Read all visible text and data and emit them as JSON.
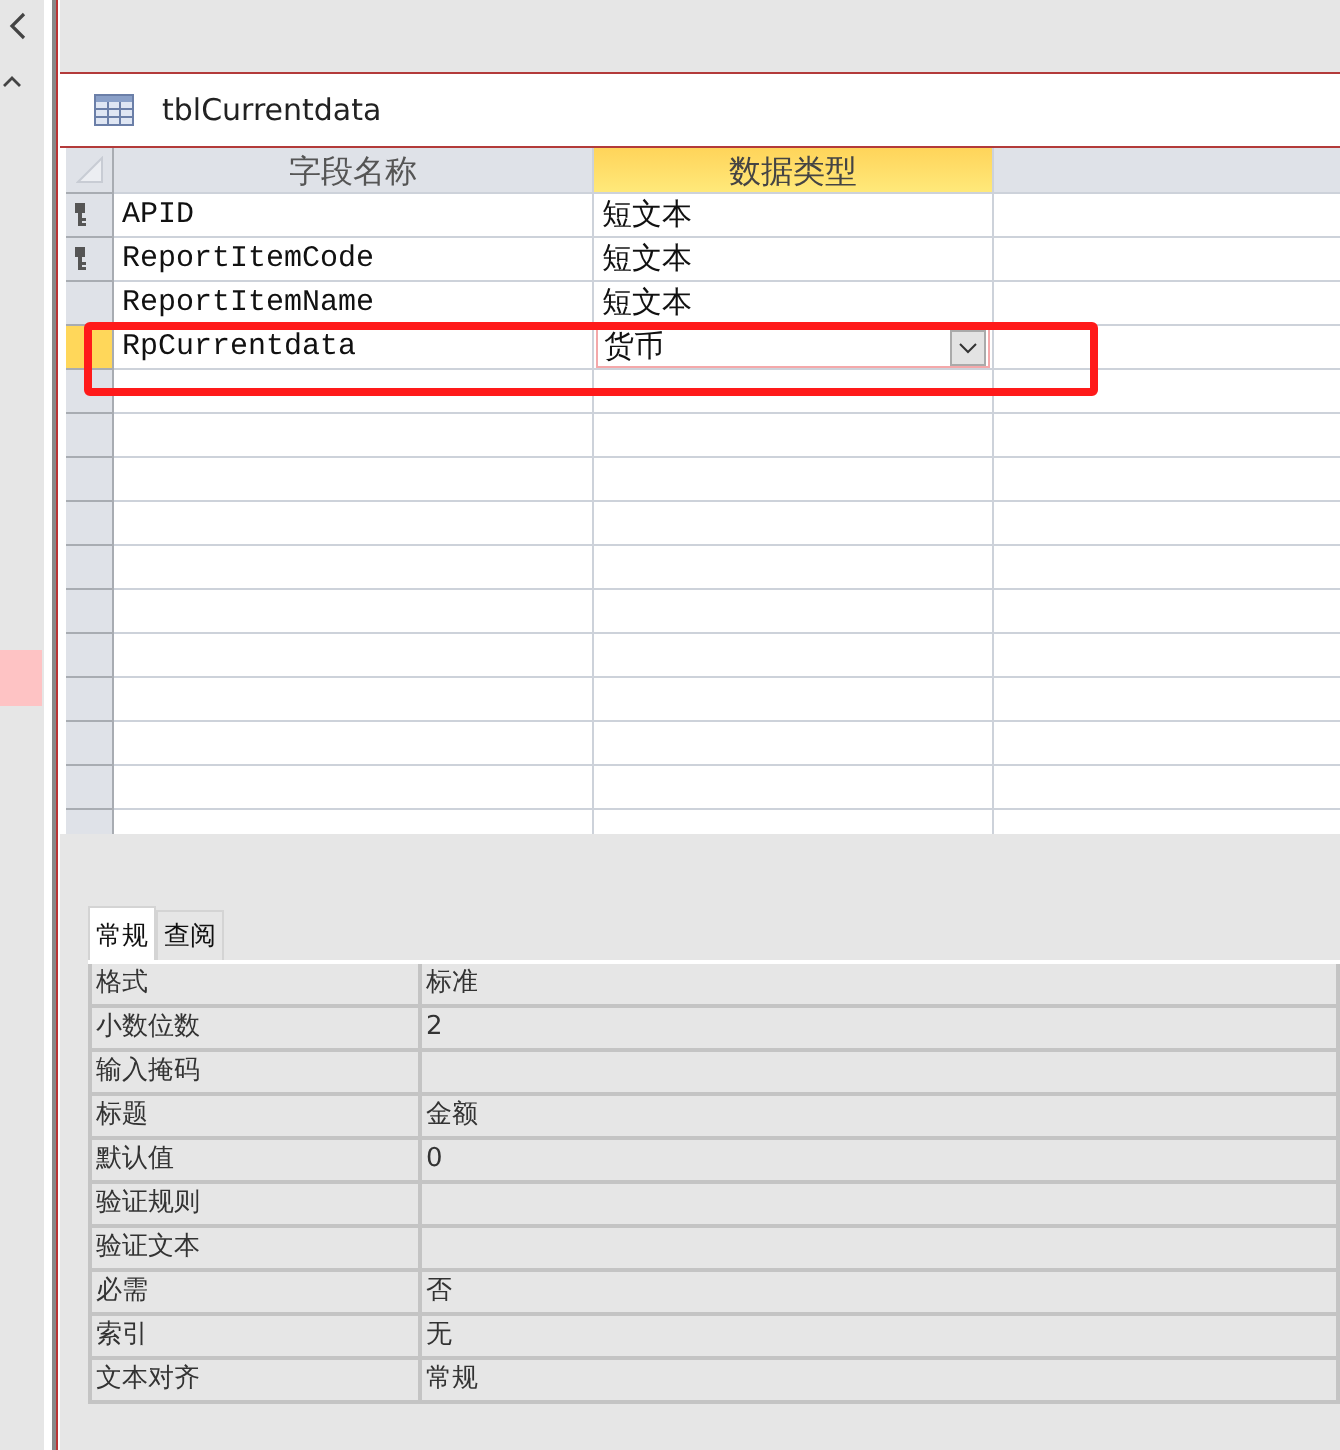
{
  "table_title": "tblCurrentdata",
  "grid": {
    "columns": [
      {
        "label": "字段名称",
        "selected": false
      },
      {
        "label": "数据类型",
        "selected": true
      }
    ],
    "rows": [
      {
        "name": "APID",
        "type": "短文本",
        "primary_key": true,
        "selected": false
      },
      {
        "name": "ReportItemCode",
        "type": "短文本",
        "primary_key": true,
        "selected": false
      },
      {
        "name": "ReportItemName",
        "type": "短文本",
        "primary_key": false,
        "selected": false
      },
      {
        "name": "RpCurrentdata",
        "type": "货币",
        "primary_key": false,
        "selected": true
      }
    ]
  },
  "properties": {
    "tabs": [
      {
        "label": "常规",
        "selected": true
      },
      {
        "label": "查阅",
        "selected": false
      }
    ],
    "rows": [
      {
        "label": "格式",
        "value": "标准"
      },
      {
        "label": "小数位数",
        "value": "2"
      },
      {
        "label": "输入掩码"
      },
      {
        "label": "标题",
        "value": "金额"
      },
      {
        "label": "默认值",
        "value": "0"
      },
      {
        "label": "验证规则"
      },
      {
        "label": "验证文本"
      },
      {
        "label": "必需",
        "value": "否"
      },
      {
        "label": "索引",
        "value": "无"
      },
      {
        "label": "文本对齐",
        "value": "常规"
      }
    ]
  }
}
